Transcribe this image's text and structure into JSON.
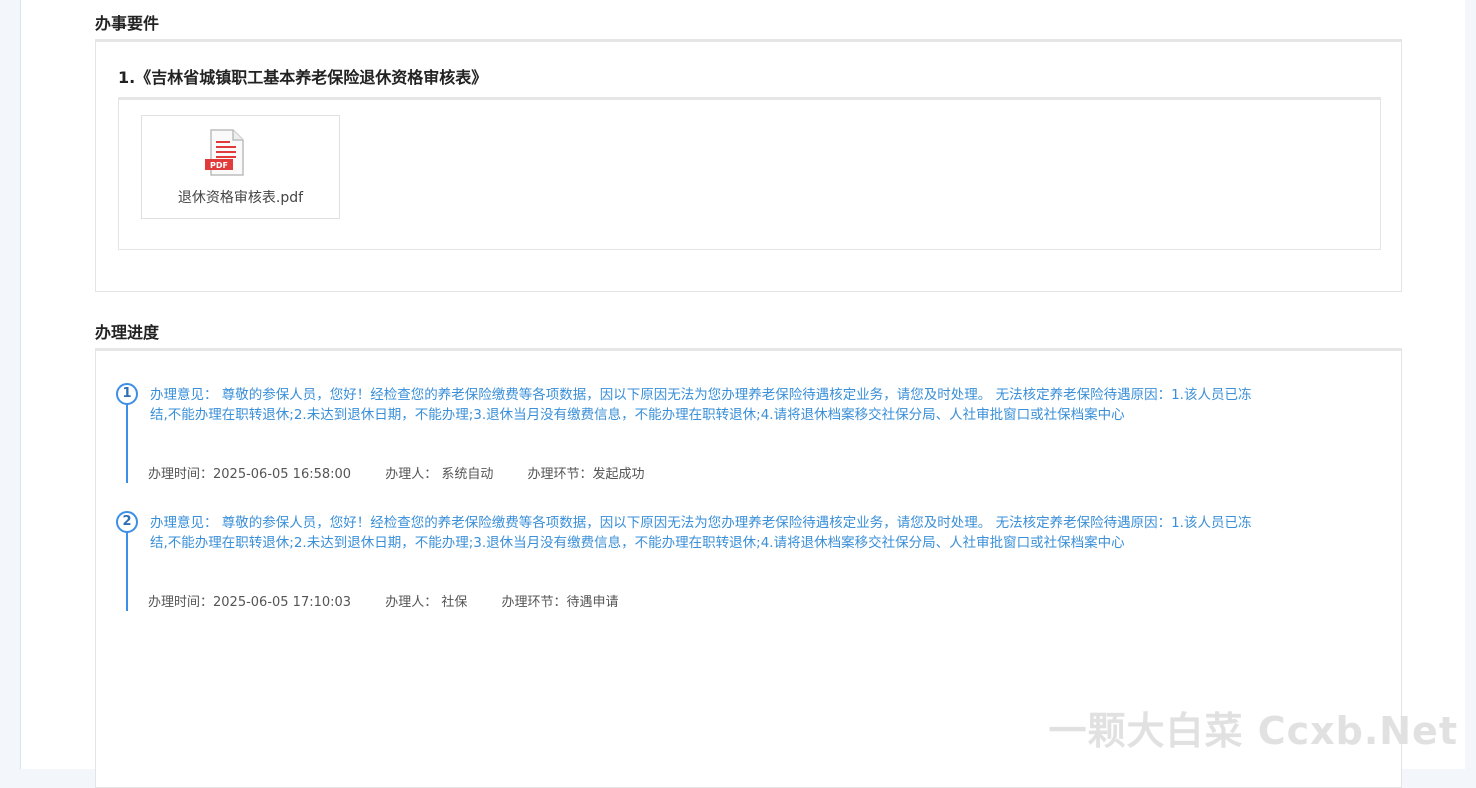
{
  "requirements": {
    "section_title": "办事要件",
    "item_title": "1.《吉林省城镇职工基本养老保险退休资格审核表》",
    "file": {
      "name": "退休资格审核表.pdf",
      "icon": "pdf-file-icon",
      "badge": "PDF"
    }
  },
  "progress": {
    "section_title": "办理进度",
    "steps": [
      {
        "number": "1",
        "opinion": "办理意见：  尊敬的参保人员，您好！经检查您的养老保险缴费等各项数据，因以下原因无法为您办理养老保险待遇核定业务，请您及时处理。 无法核定养老保险待遇原因：1.该人员已冻结,不能办理在职转退休;2.未达到退休日期，不能办理;3.退休当月没有缴费信息，不能办理在职转退休;4.请将退休档案移交社保分局、人社审批窗口或社保档案中心",
        "time": "办理时间：2025-06-05 16:58:00",
        "handler": "办理人：  系统自动",
        "stage": "办理环节：发起成功"
      },
      {
        "number": "2",
        "opinion": "办理意见：  尊敬的参保人员，您好！经检查您的养老保险缴费等各项数据，因以下原因无法为您办理养老保险待遇核定业务，请您及时处理。 无法核定养老保险待遇原因：1.该人员已冻结,不能办理在职转退休;2.未达到退休日期，不能办理;3.退休当月没有缴费信息，不能办理在职转退休;4.请将退休档案移交社保分局、人社审批窗口或社保档案中心",
        "time": "办理时间：2025-06-05 17:10:03",
        "handler": "办理人：  社保",
        "stage": "办理环节：待遇申请"
      }
    ]
  },
  "watermark": "一颗大白菜 Ccxb.Net",
  "colors": {
    "accent": "#3d8ee6",
    "opinion_text": "#3a8fd8",
    "pdf_red": "#e03a3a"
  }
}
